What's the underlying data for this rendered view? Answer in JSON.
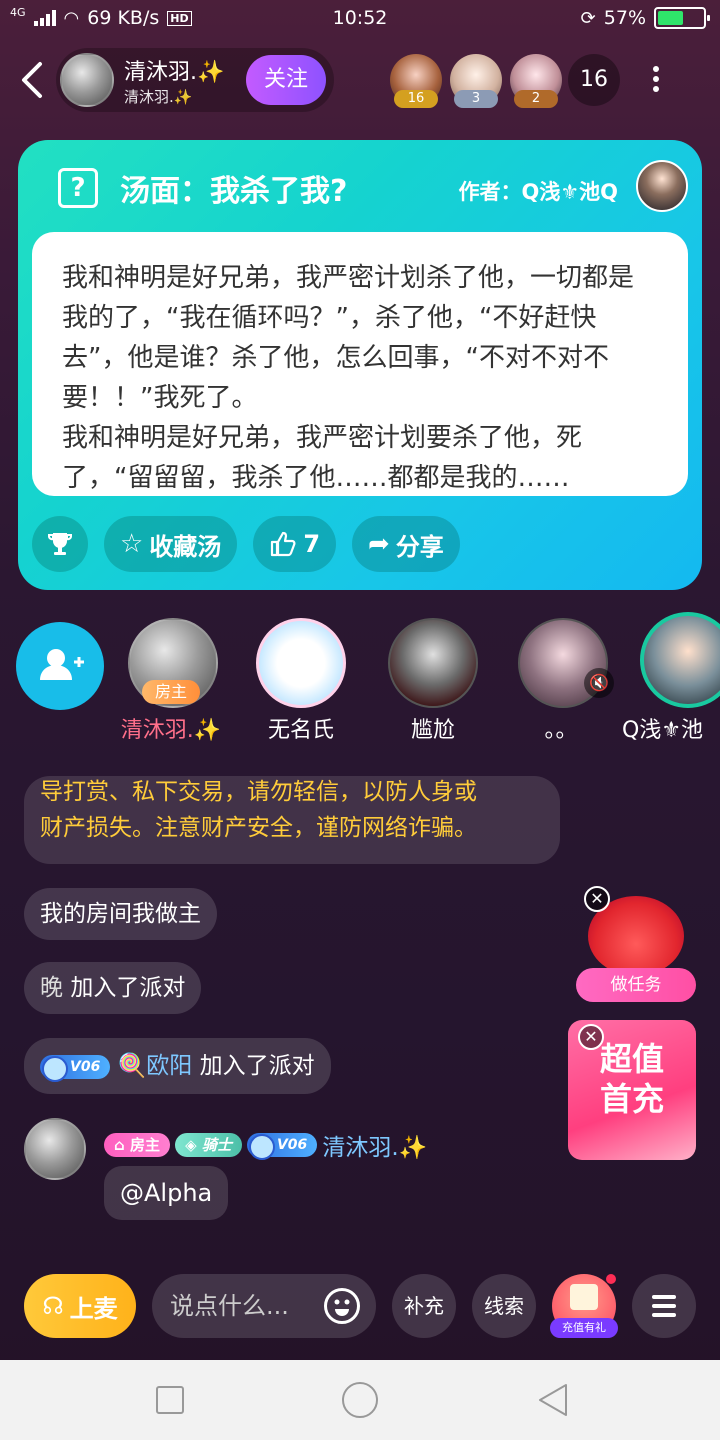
{
  "status_bar": {
    "network_type": "4G",
    "speed": "69 KB/s",
    "hd": "HD",
    "time": "10:52",
    "battery": "57%",
    "battery_level": 0.57
  },
  "header": {
    "host_name": "清沐羽.✨",
    "host_id": "清沐羽.✨",
    "follow_label": "关注",
    "top_fans": [
      {
        "rank": "16",
        "badge_color": "#d4a020"
      },
      {
        "rank": "3",
        "badge_color": "#8c9bb5"
      },
      {
        "rank": "2",
        "badge_color": "#b06a2a"
      }
    ],
    "audience_count": "16"
  },
  "puzzle_card": {
    "title": "汤面：我杀了我?",
    "author": "作者：Q浅⚜池Q",
    "story": "我和神明是好兄弟，我严密计划杀了他，一切都是我的了，“我在循环吗？”，杀了他，“不好赶快去”，他是谁？杀了他，怎么回事，“不对不对不要！！”我死了。\n我和神明是好兄弟，我严密计划要杀了他，死了，“留留留，我杀了他……都都是我的……",
    "collect_label": "收藏汤",
    "like_count": "7",
    "share_label": "分享",
    "accent_color": "#18c6e8"
  },
  "seats": [
    {
      "name": "清沐羽.✨",
      "badge": "房主",
      "name_color": "#ff6f8a"
    },
    {
      "name": "无名氏",
      "badge": "",
      "name_color": "#ffffff"
    },
    {
      "name": "尴尬",
      "badge": "",
      "name_color": "#ffffff"
    },
    {
      "name": "。。",
      "badge": "",
      "name_color": "#ffffff"
    },
    {
      "name": "Q浅⚜池",
      "badge": "",
      "name_color": "#ffffff"
    }
  ],
  "chat": {
    "notice_line1": "导打赏、私下交易，请勿轻信，以防人身或",
    "notice_line2": "财产损失。注意财产安全，谨防网络诈骗。",
    "msg1": "我的房间我做主",
    "join1_user": "晚",
    "join1_text": "加入了派对",
    "join2_level": "V06",
    "join2_user": "🍭欧阳",
    "join2_text": "加入了派对",
    "sender_tag_host": "房主",
    "sender_tag_knight": "骑士",
    "sender_level": "V06",
    "sender_name": "清沐羽.✨",
    "sender_message": "@Alpha"
  },
  "promos": {
    "task_label": "做任务",
    "first_charge_line1": "超值",
    "first_charge_line2": "首充"
  },
  "bottom_bar": {
    "mic_label": "上麦",
    "input_placeholder": "说点什么...",
    "supplement_label": "补充",
    "clue_label": "线索",
    "charge_gift_label": "充值有礼"
  }
}
